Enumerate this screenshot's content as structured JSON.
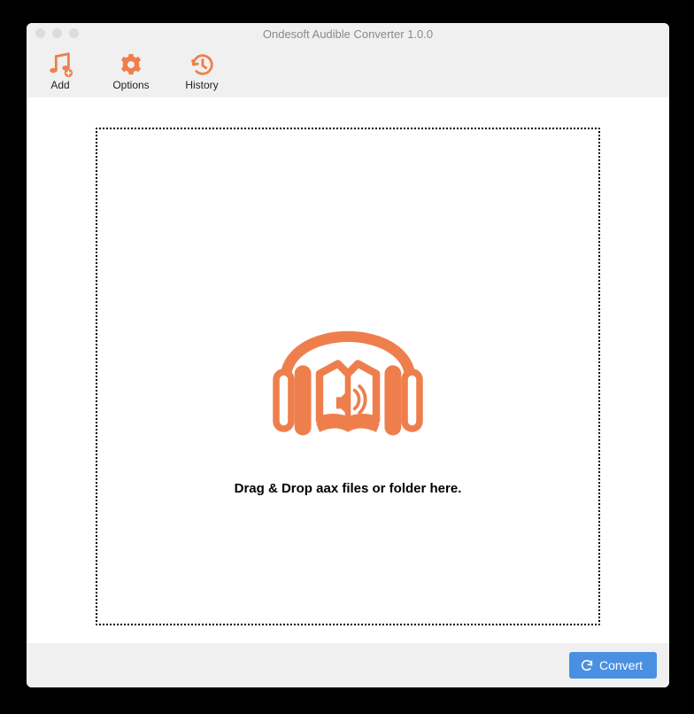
{
  "window": {
    "title": "Ondesoft Audible Converter 1.0.0"
  },
  "toolbar": {
    "add_label": "Add",
    "options_label": "Options",
    "history_label": "History"
  },
  "dropzone": {
    "message": "Drag & Drop aax files or folder here."
  },
  "footer": {
    "convert_label": "Convert"
  },
  "colors": {
    "accent": "#ee7f4d",
    "primary_button": "#4a90e2"
  }
}
